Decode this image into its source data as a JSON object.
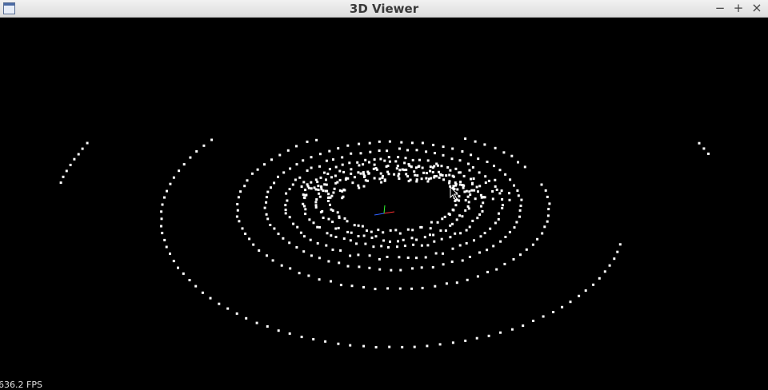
{
  "window": {
    "title": "3D Viewer"
  },
  "controls": {
    "minimize": "−",
    "maximize": "+",
    "close": "×"
  },
  "icons": {
    "app": "window-icon",
    "axes": "xyz-axes-icon",
    "cursor": "mouse-cursor-icon"
  },
  "status": {
    "fps": "636.2 FPS"
  },
  "colors": {
    "background": "#000000",
    "points": "#ffffff",
    "axis_x": "#ff3030",
    "axis_y": "#30ff30",
    "axis_z": "#3060ff"
  }
}
